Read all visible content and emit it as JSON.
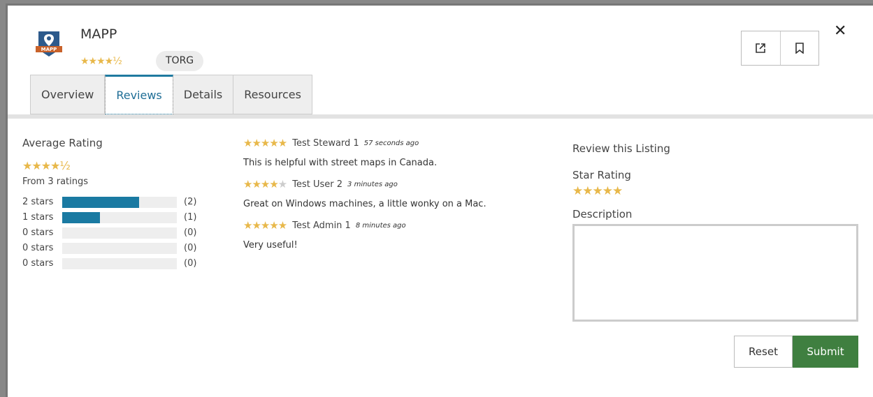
{
  "app": {
    "title": "MAPP",
    "logo_text": "MAPP",
    "header_rating": "★★★★½",
    "tag": "TORG"
  },
  "actions": {
    "open_icon": "external-link-icon",
    "bookmark_icon": "bookmark-icon",
    "close_label": "✕"
  },
  "tabs": [
    {
      "label": "Overview"
    },
    {
      "label": "Reviews",
      "active": true
    },
    {
      "label": "Details"
    },
    {
      "label": "Resources"
    }
  ],
  "average": {
    "heading": "Average Rating",
    "stars": "★★★★½",
    "from": "From 3 ratings",
    "bars": [
      {
        "label": "2 stars",
        "fraction": 0.67,
        "count": "(2)"
      },
      {
        "label": "1 stars",
        "fraction": 0.33,
        "count": "(1)"
      },
      {
        "label": "0 stars",
        "fraction": 0,
        "count": "(0)"
      },
      {
        "label": "0 stars",
        "fraction": 0,
        "count": "(0)"
      },
      {
        "label": "0 stars",
        "fraction": 0,
        "count": "(0)"
      }
    ]
  },
  "reviews": [
    {
      "stars_on": "★★★★★",
      "stars_off": "",
      "user": "Test Steward 1",
      "time": "57 seconds ago",
      "text": "This is helpful with street maps in Canada."
    },
    {
      "stars_on": "★★★★",
      "stars_off": "★",
      "user": "Test User 2",
      "time": "3 minutes ago",
      "text": "Great on Windows machines, a little wonky on a Mac."
    },
    {
      "stars_on": "★★★★★",
      "stars_off": "",
      "user": "Test Admin 1",
      "time": "8 minutes ago",
      "text": "Very useful!"
    }
  ],
  "review_form": {
    "heading": "Review this Listing",
    "star_label": "Star Rating",
    "stars": "★★★★★",
    "description_label": "Description",
    "description_value": "",
    "reset_label": "Reset",
    "submit_label": "Submit"
  },
  "colors": {
    "accent": "#1f7aa0",
    "star": "#e8b84a",
    "submit": "#3f7f40"
  }
}
